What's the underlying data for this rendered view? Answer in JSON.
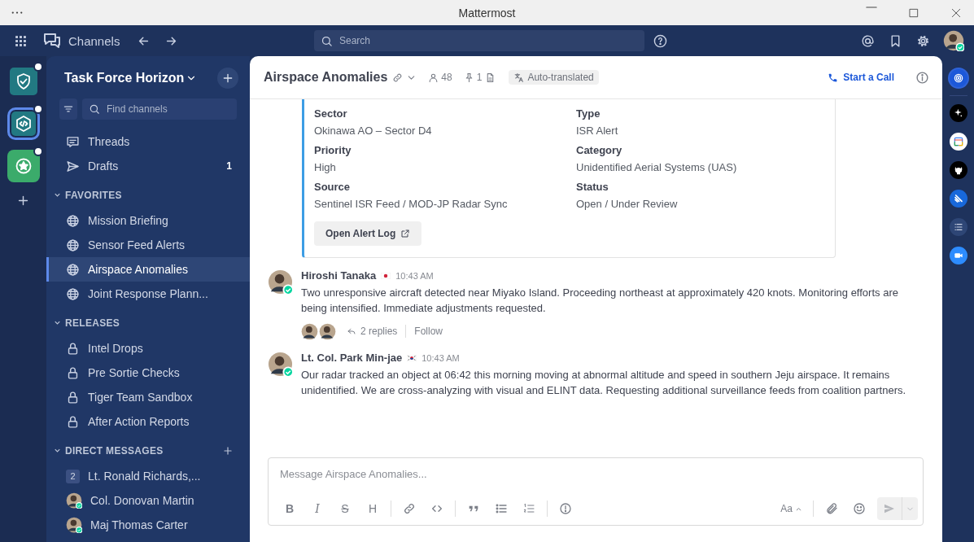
{
  "window": {
    "title": "Mattermost"
  },
  "top_bar": {
    "title": "Channels",
    "search": {
      "placeholder": "Search"
    },
    "user_online": true
  },
  "teams": [
    {
      "kind": "shield",
      "selected": false,
      "unread": true
    },
    {
      "kind": "code",
      "selected": true,
      "unread": true
    },
    {
      "kind": "star",
      "selected": false,
      "unread": true
    }
  ],
  "sidebar": {
    "team_name": "Task Force Horizon",
    "filter": {
      "placeholder": "Find channels"
    },
    "top_items": [
      {
        "kind": "threads",
        "label": "Threads"
      },
      {
        "kind": "drafts",
        "label": "Drafts",
        "count": "1"
      }
    ],
    "sections": [
      {
        "title": "FAVORITES",
        "expanded": true,
        "can_add": false,
        "items": [
          {
            "kind": "public",
            "label": "Mission Briefing",
            "selected": false
          },
          {
            "kind": "public",
            "label": "Sensor Feed Alerts",
            "selected": false
          },
          {
            "kind": "public",
            "label": "Airspace Anomalies",
            "selected": true
          },
          {
            "kind": "public",
            "label": "Joint Response Plann...",
            "selected": false
          }
        ]
      },
      {
        "title": "RELEASES",
        "expanded": true,
        "can_add": false,
        "items": [
          {
            "kind": "private",
            "label": "Intel Drops",
            "selected": false
          },
          {
            "kind": "private",
            "label": "Pre Sortie Checks",
            "selected": false
          },
          {
            "kind": "private",
            "label": "Tiger Team Sandbox",
            "selected": false
          },
          {
            "kind": "private",
            "label": "After Action Reports",
            "selected": false
          }
        ]
      },
      {
        "title": "DIRECT MESSAGES",
        "expanded": true,
        "can_add": true,
        "items": [
          {
            "kind": "group",
            "badge": "2",
            "label": "Lt. Ronald Richards,...",
            "selected": false
          },
          {
            "kind": "user",
            "label": "Col. Donovan Martin",
            "online": true,
            "selected": false
          },
          {
            "kind": "user",
            "label": "Maj Thomas Carter",
            "online": true,
            "selected": false
          }
        ]
      }
    ]
  },
  "channel_header": {
    "name": "Airspace Anomalies",
    "members": "48",
    "pinned": "1",
    "translation": "Auto-translated",
    "call_button": "Start a Call"
  },
  "alert_card": {
    "fields": [
      {
        "label": "Sector",
        "value": "Okinawa AO – Sector D4"
      },
      {
        "label": "Type",
        "value": "ISR Alert"
      },
      {
        "label": "Priority",
        "value": "High"
      },
      {
        "label": "Category",
        "value": "Unidentified Aerial Systems (UAS)"
      },
      {
        "label": "Source",
        "value": "Sentinel ISR Feed / MOD-JP Radar Sync"
      },
      {
        "label": "Status",
        "value": "Open / Under Review"
      }
    ],
    "button": "Open Alert Log"
  },
  "posts": [
    {
      "author": "Hiroshi Tanaka",
      "flag": {
        "kind": "jp"
      },
      "online": true,
      "time": "10:43 AM",
      "text": "Two unresponsive aircraft detected near Miyako Island. Proceeding northeast at approximately 420 knots. Monitoring efforts are being intensified. Immediate adjustments requested.",
      "thread": {
        "replies": "2 replies",
        "follow": "Follow"
      }
    },
    {
      "author": "Lt. Col. Park Min-jae",
      "flag": {
        "kind": "kr"
      },
      "online": true,
      "time": "10:43 AM",
      "text": "Our radar tracked an object at 06:42 this morning moving at abnormal altitude and speed in southern Jeju airspace. It remains unidentified. We are cross-analyzing with visual and ELINT data. Requesting additional surveillance feeds from coalition partners."
    }
  ],
  "composer": {
    "placeholder": "Message Airspace Anomalies...",
    "format_buttons": [
      {
        "kind": "bold",
        "label": "B"
      },
      {
        "kind": "italic",
        "label": "I"
      },
      {
        "kind": "strike",
        "label": "S"
      },
      {
        "kind": "heading",
        "label": "H"
      }
    ],
    "text_style": "Aa"
  },
  "app_bar": [
    {
      "kind": "target",
      "selected": true
    },
    {
      "kind": "sparkle",
      "selected": false
    },
    {
      "kind": "calendar",
      "selected": false
    },
    {
      "kind": "cat",
      "selected": false
    },
    {
      "kind": "stripes",
      "selected": false
    },
    {
      "kind": "list",
      "selected": false
    },
    {
      "kind": "video",
      "selected": false
    }
  ]
}
